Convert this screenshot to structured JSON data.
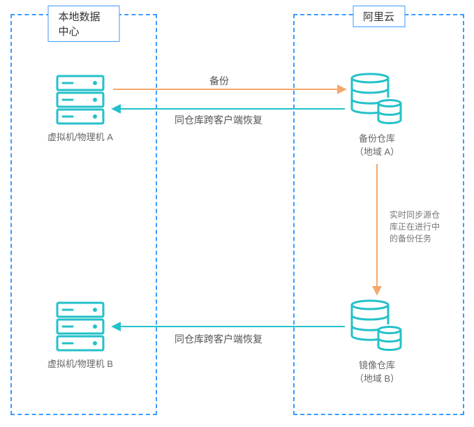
{
  "diagram": {
    "boxes": {
      "local": {
        "title": "本地数据中心"
      },
      "cloud": {
        "title": "阿里云"
      }
    },
    "nodes": {
      "vmA": {
        "label": "虚拟机/物理机 A"
      },
      "vmB": {
        "label": "虚拟机/物理机 B"
      },
      "vaultA": {
        "label_line1": "备份仓库",
        "label_line2": "（地域 A）"
      },
      "vaultB": {
        "label_line1": "镜像仓库",
        "label_line2": "（地域 B）"
      }
    },
    "edges": {
      "backup": {
        "label": "备份"
      },
      "restoreA": {
        "label": "同仓库跨客户端恢复"
      },
      "sync": {
        "label": "实时同步源仓库正在进行中的备份任务"
      },
      "restoreB": {
        "label": "同仓库跨客户端恢复"
      }
    },
    "colors": {
      "orange": "#f5a86b",
      "teal": "#24c1c9"
    }
  }
}
